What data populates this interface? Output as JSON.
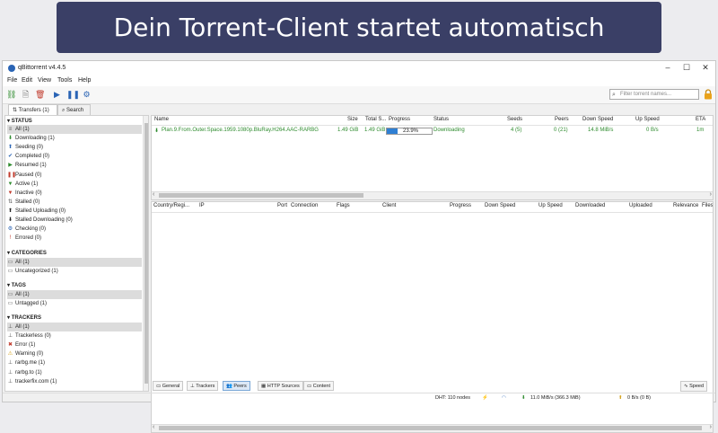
{
  "banner": {
    "text": "Dein Torrent-Client startet automatisch"
  },
  "window": {
    "title": "qBittorrent v4.4.5",
    "controls": [
      "–",
      "☐",
      "✕"
    ]
  },
  "menu": [
    "File",
    "Edit",
    "View",
    "Tools",
    "Help"
  ],
  "toolbar": {
    "icons": [
      "add-link-icon",
      "add-file-icon",
      "delete-icon",
      "resume-icon",
      "pause-icon",
      "options-icon"
    ],
    "filter_placeholder": "Filter torrent names..."
  },
  "tabs": [
    "Transfers (1)",
    "Search"
  ],
  "sidebar": {
    "status": {
      "title": "STATUS",
      "items": [
        {
          "label": "All (1)",
          "icon": "≡",
          "color": "#555"
        },
        {
          "label": "Downloading (1)",
          "icon": "⬇",
          "color": "#2e8b2e"
        },
        {
          "label": "Seeding (0)",
          "icon": "⬆",
          "color": "#2a64b5"
        },
        {
          "label": "Completed (0)",
          "icon": "✔",
          "color": "#2a64b5"
        },
        {
          "label": "Resumed (1)",
          "icon": "▶",
          "color": "#2e8b2e"
        },
        {
          "label": "Paused (0)",
          "icon": "❚❚",
          "color": "#c0392b"
        },
        {
          "label": "Active (1)",
          "icon": "▼",
          "color": "#2e8b2e"
        },
        {
          "label": "Inactive (0)",
          "icon": "▼",
          "color": "#c0392b"
        },
        {
          "label": "Stalled (0)",
          "icon": "⇅",
          "color": "#555"
        },
        {
          "label": "Stalled Uploading (0)",
          "icon": "⬆",
          "color": "#222"
        },
        {
          "label": "Stalled Downloading (0)",
          "icon": "⬇",
          "color": "#222"
        },
        {
          "label": "Checking (0)",
          "icon": "⚙",
          "color": "#2a64b5"
        },
        {
          "label": "Errored (0)",
          "icon": "!",
          "color": "#c0392b"
        }
      ]
    },
    "categories": {
      "title": "CATEGORIES",
      "items": [
        {
          "label": "All (1)",
          "icon": "▭",
          "color": "#555"
        },
        {
          "label": "Uncategorized (1)",
          "icon": "▭",
          "color": "#555"
        }
      ]
    },
    "tags": {
      "title": "TAGS",
      "items": [
        {
          "label": "All (1)",
          "icon": "▭",
          "color": "#555"
        },
        {
          "label": "Untagged (1)",
          "icon": "▭",
          "color": "#555"
        }
      ]
    },
    "trackers": {
      "title": "TRACKERS",
      "items": [
        {
          "label": "All (1)",
          "icon": "⊥",
          "color": "#555"
        },
        {
          "label": "Trackerless (0)",
          "icon": "⊥",
          "color": "#555"
        },
        {
          "label": "Error (1)",
          "icon": "✖",
          "color": "#c0392b"
        },
        {
          "label": "Warning (0)",
          "icon": "⚠",
          "color": "#d4a017"
        },
        {
          "label": "rarbg.me (1)",
          "icon": "⊥",
          "color": "#555"
        },
        {
          "label": "rarbg.to (1)",
          "icon": "⊥",
          "color": "#555"
        },
        {
          "label": "trackerfix.com (1)",
          "icon": "⊥",
          "color": "#555"
        }
      ]
    }
  },
  "torrents": {
    "columns": [
      "Name",
      "Size",
      "Total S...",
      "Progress",
      "Status",
      "Seeds",
      "Peers",
      "Down Speed",
      "Up Speed",
      "ETA"
    ],
    "rows": [
      {
        "name": "Plan.9.From.Outer.Space.1959.1080p.BluRay.H264.AAC-RARBG",
        "size": "1.49 GiB",
        "total": "1.49 GiB",
        "progress_text": "23.9%",
        "progress": 0.239,
        "status": "Downloading",
        "seeds": "4 (5)",
        "peers": "0 (21)",
        "down": "14.8 MiB/s",
        "up": "0 B/s",
        "eta": "1m"
      }
    ]
  },
  "peers": {
    "columns": [
      "Country/Regi...",
      "IP",
      "Port",
      "Connection",
      "Flags",
      "Client",
      "Progress",
      "Down Speed",
      "Up Speed",
      "Downloaded",
      "Uploaded",
      "Relevance",
      "Files"
    ]
  },
  "bottom_tabs": [
    "General",
    "Trackers",
    "Peers",
    "HTTP Sources",
    "Content"
  ],
  "speed_button": "Speed",
  "statusbar": {
    "dht": "DHT: 110 nodes",
    "down": "11.0 MiB/s (366.3 MiB)",
    "up": "0 B/s (0 B)"
  }
}
